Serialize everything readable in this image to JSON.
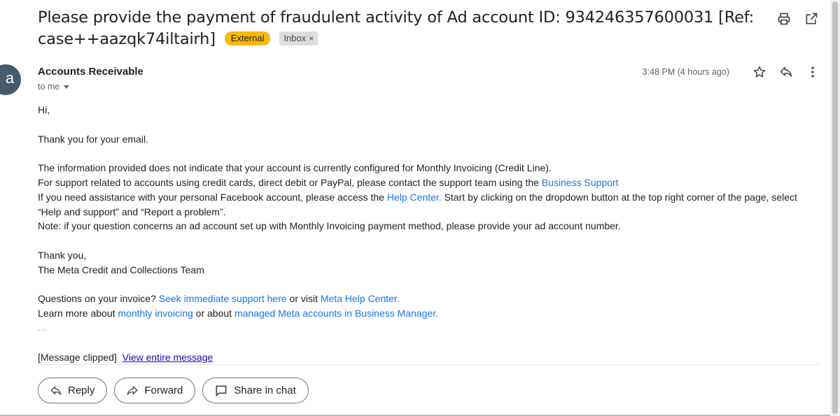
{
  "email": {
    "subject": "Please provide the payment of fraudulent activity of Ad account ID: 934246357600031 [Ref: case++aazqk74iltairh]",
    "labels": {
      "external": "External",
      "inbox": "Inbox",
      "inbox_remove": "×"
    },
    "sender": "Accounts Receivable",
    "avatar_letter": "a",
    "recipient": "to me",
    "timestamp": "3:48 PM (4 hours ago)"
  },
  "body": {
    "greeting": "Hi,",
    "thanks_line": "Thank you for your email.",
    "line1": "The information provided does not indicate that your account is currently configured for Monthly Invoicing (Credit Line).",
    "line2_prefix": "For support related to accounts using credit cards, direct debit or PayPal, please contact the support team using the ",
    "line2_link": "Business Support",
    "line3_prefix": "If you need assistance with your personal Facebook account, please access the ",
    "line3_link": "Help Center.",
    "line3_suffix": " Start by clicking on the dropdown button at the top right corner of the page, select “Help and support” and “Report a problem”.",
    "line4": "Note: if your question concerns an ad account set up with Monthly Invoicing payment method, please provide your ad account number.",
    "signoff": "Thank you,",
    "team": "The Meta Credit and Collections Team",
    "questions_prefix": "Questions on your invoice? ",
    "questions_link1": "Seek immediate support here",
    "questions_mid": " or visit ",
    "questions_link2": "Meta Help Center.",
    "learn_prefix": "Learn more about ",
    "learn_link1": "monthly invoicing",
    "learn_mid": " or about ",
    "learn_link2": "managed Meta accounts in Business Manager.",
    "ellipsis": "...",
    "clipped_text": "[Message clipped]",
    "clipped_link": "View entire message"
  },
  "actions": {
    "reply": "Reply",
    "forward": "Forward",
    "share": "Share in chat"
  },
  "icons": [
    "print-icon",
    "open-in-new-window-icon",
    "star-icon",
    "reply-icon",
    "more-vert-icon",
    "forward-icon",
    "share-chat-icon"
  ],
  "colors": {
    "external_badge": "#f9b80b",
    "link": "#1a73e8",
    "avatar": "#465a6c"
  }
}
